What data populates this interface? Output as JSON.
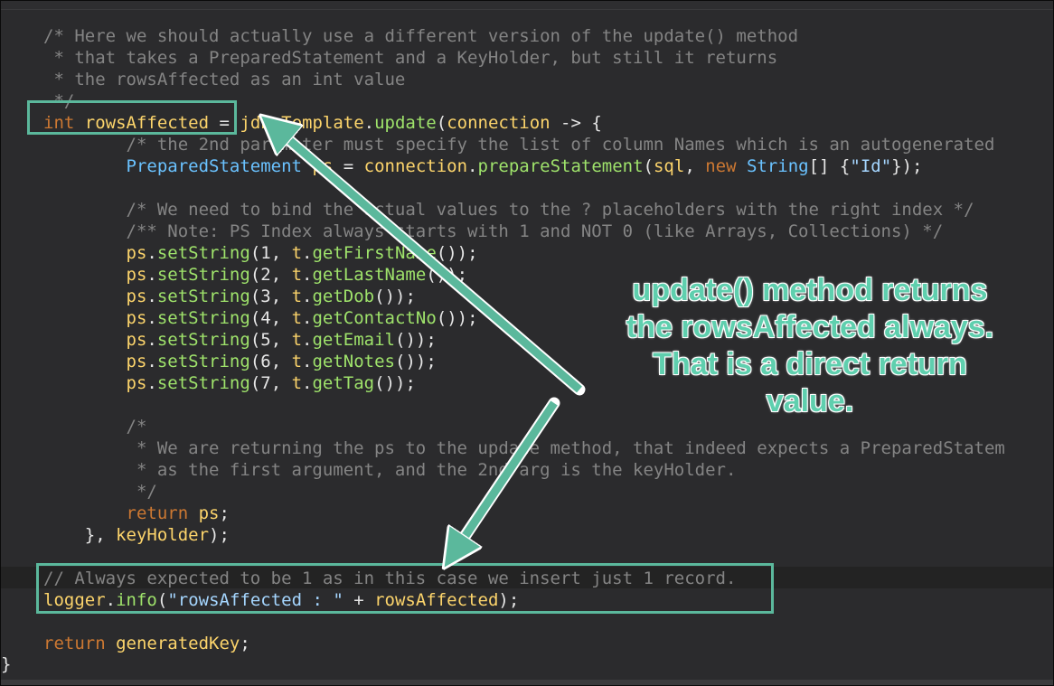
{
  "editor": {
    "lines": [
      {
        "id": "l1",
        "tokens": [
          {
            "t": "c",
            "x": "/* Here we should actually use a different version of the update() method"
          }
        ]
      },
      {
        "id": "l2",
        "tokens": [
          {
            "t": "c",
            "x": " * that takes a PreparedStatement and a KeyHolder, but still it returns"
          }
        ]
      },
      {
        "id": "l3",
        "tokens": [
          {
            "t": "c",
            "x": " * the rowsAffected as an int value"
          }
        ]
      },
      {
        "id": "l4",
        "tokens": [
          {
            "t": "c",
            "x": " */"
          }
        ]
      },
      {
        "id": "l5",
        "tokens": [
          {
            "t": "kw",
            "x": "int "
          },
          {
            "t": "v",
            "x": "rowsAffected"
          },
          {
            "t": "p",
            "x": " = "
          },
          {
            "t": "v",
            "x": "jdbcTemplate"
          },
          {
            "t": "p",
            "x": "."
          },
          {
            "t": "m",
            "x": "update"
          },
          {
            "t": "p",
            "x": "("
          },
          {
            "t": "v",
            "x": "connection"
          },
          {
            "t": "p",
            "x": " -> {"
          }
        ]
      },
      {
        "id": "l6",
        "tokens": [
          {
            "t": "c",
            "x": "        /* the 2nd parameter must specify the list of column Names which is an autogenerated"
          }
        ]
      },
      {
        "id": "l7",
        "tokens": [
          {
            "t": "p",
            "x": "        "
          },
          {
            "t": "s",
            "x": "PreparedStatement"
          },
          {
            "t": "p",
            "x": " "
          },
          {
            "t": "v",
            "x": "ps"
          },
          {
            "t": "p",
            "x": " = "
          },
          {
            "t": "v",
            "x": "connection"
          },
          {
            "t": "p",
            "x": "."
          },
          {
            "t": "m",
            "x": "prepareStatement"
          },
          {
            "t": "p",
            "x": "("
          },
          {
            "t": "v",
            "x": "sql"
          },
          {
            "t": "p",
            "x": ", "
          },
          {
            "t": "kw",
            "x": "new "
          },
          {
            "t": "s",
            "x": "String"
          },
          {
            "t": "p",
            "x": "[] {"
          },
          {
            "t": "st",
            "x": "\"Id\""
          },
          {
            "t": "p",
            "x": "});"
          }
        ]
      },
      {
        "id": "l8",
        "tokens": []
      },
      {
        "id": "l9",
        "tokens": [
          {
            "t": "c",
            "x": "        /* We need to bind the actual values to the ? placeholders with the right index */"
          }
        ]
      },
      {
        "id": "l10",
        "tokens": [
          {
            "t": "c",
            "x": "        /** Note: PS Index always starts with 1 and NOT 0 (like Arrays, Collections) */"
          }
        ]
      },
      {
        "id": "l11",
        "tokens": [
          {
            "t": "p",
            "x": "        "
          },
          {
            "t": "v",
            "x": "ps"
          },
          {
            "t": "p",
            "x": "."
          },
          {
            "t": "m",
            "x": "setString"
          },
          {
            "t": "p",
            "x": "(1, "
          },
          {
            "t": "v",
            "x": "t"
          },
          {
            "t": "p",
            "x": "."
          },
          {
            "t": "m",
            "x": "getFirstName"
          },
          {
            "t": "p",
            "x": "());"
          }
        ]
      },
      {
        "id": "l12",
        "tokens": [
          {
            "t": "p",
            "x": "        "
          },
          {
            "t": "v",
            "x": "ps"
          },
          {
            "t": "p",
            "x": "."
          },
          {
            "t": "m",
            "x": "setString"
          },
          {
            "t": "p",
            "x": "(2, "
          },
          {
            "t": "v",
            "x": "t"
          },
          {
            "t": "p",
            "x": "."
          },
          {
            "t": "m",
            "x": "getLastName"
          },
          {
            "t": "p",
            "x": "());"
          }
        ]
      },
      {
        "id": "l13",
        "tokens": [
          {
            "t": "p",
            "x": "        "
          },
          {
            "t": "v",
            "x": "ps"
          },
          {
            "t": "p",
            "x": "."
          },
          {
            "t": "m",
            "x": "setString"
          },
          {
            "t": "p",
            "x": "(3, "
          },
          {
            "t": "v",
            "x": "t"
          },
          {
            "t": "p",
            "x": "."
          },
          {
            "t": "m",
            "x": "getDob"
          },
          {
            "t": "p",
            "x": "());"
          }
        ]
      },
      {
        "id": "l14",
        "tokens": [
          {
            "t": "p",
            "x": "        "
          },
          {
            "t": "v",
            "x": "ps"
          },
          {
            "t": "p",
            "x": "."
          },
          {
            "t": "m",
            "x": "setString"
          },
          {
            "t": "p",
            "x": "(4, "
          },
          {
            "t": "v",
            "x": "t"
          },
          {
            "t": "p",
            "x": "."
          },
          {
            "t": "m",
            "x": "getContactNo"
          },
          {
            "t": "p",
            "x": "());"
          }
        ]
      },
      {
        "id": "l15",
        "tokens": [
          {
            "t": "p",
            "x": "        "
          },
          {
            "t": "v",
            "x": "ps"
          },
          {
            "t": "p",
            "x": "."
          },
          {
            "t": "m",
            "x": "setString"
          },
          {
            "t": "p",
            "x": "(5, "
          },
          {
            "t": "v",
            "x": "t"
          },
          {
            "t": "p",
            "x": "."
          },
          {
            "t": "m",
            "x": "getEmail"
          },
          {
            "t": "p",
            "x": "());"
          }
        ]
      },
      {
        "id": "l16",
        "tokens": [
          {
            "t": "p",
            "x": "        "
          },
          {
            "t": "v",
            "x": "ps"
          },
          {
            "t": "p",
            "x": "."
          },
          {
            "t": "m",
            "x": "setString"
          },
          {
            "t": "p",
            "x": "(6, "
          },
          {
            "t": "v",
            "x": "t"
          },
          {
            "t": "p",
            "x": "."
          },
          {
            "t": "m",
            "x": "getNotes"
          },
          {
            "t": "p",
            "x": "());"
          }
        ]
      },
      {
        "id": "l17",
        "tokens": [
          {
            "t": "p",
            "x": "        "
          },
          {
            "t": "v",
            "x": "ps"
          },
          {
            "t": "p",
            "x": "."
          },
          {
            "t": "m",
            "x": "setString"
          },
          {
            "t": "p",
            "x": "(7, "
          },
          {
            "t": "v",
            "x": "t"
          },
          {
            "t": "p",
            "x": "."
          },
          {
            "t": "m",
            "x": "getTag"
          },
          {
            "t": "p",
            "x": "());"
          }
        ]
      },
      {
        "id": "l18",
        "tokens": []
      },
      {
        "id": "l19",
        "tokens": [
          {
            "t": "c",
            "x": "        /*"
          }
        ]
      },
      {
        "id": "l20",
        "tokens": [
          {
            "t": "c",
            "x": "         * We are returning the ps to the update method, that indeed expects a PreparedStatem"
          }
        ]
      },
      {
        "id": "l21",
        "tokens": [
          {
            "t": "c",
            "x": "         * as the first argument, and the 2nd arg is the keyHolder."
          }
        ]
      },
      {
        "id": "l22",
        "tokens": [
          {
            "t": "c",
            "x": "         */"
          }
        ]
      },
      {
        "id": "l23",
        "tokens": [
          {
            "t": "p",
            "x": "        "
          },
          {
            "t": "kw",
            "x": "return "
          },
          {
            "t": "v",
            "x": "ps"
          },
          {
            "t": "p",
            "x": ";"
          }
        ]
      },
      {
        "id": "l24",
        "tokens": [
          {
            "t": "p",
            "x": "    }, "
          },
          {
            "t": "v",
            "x": "keyHolder"
          },
          {
            "t": "p",
            "x": ");"
          }
        ]
      },
      {
        "id": "l25",
        "tokens": []
      },
      {
        "id": "l26",
        "tokens": [
          {
            "t": "c",
            "x": "// Always expected to be 1 as in this case we insert just 1 record."
          }
        ]
      },
      {
        "id": "l27",
        "tokens": [
          {
            "t": "v",
            "x": "logger"
          },
          {
            "t": "p",
            "x": "."
          },
          {
            "t": "m",
            "x": "info"
          },
          {
            "t": "p",
            "x": "("
          },
          {
            "t": "st",
            "x": "\"rowsAffected : \""
          },
          {
            "t": "p",
            "x": " + "
          },
          {
            "t": "v",
            "x": "rowsAffected"
          },
          {
            "t": "p",
            "x": ");"
          }
        ]
      },
      {
        "id": "l28",
        "tokens": []
      },
      {
        "id": "l29",
        "tokens": [
          {
            "t": "kw",
            "x": "return "
          },
          {
            "t": "v",
            "x": "generatedKey"
          },
          {
            "t": "p",
            "x": ";"
          }
        ]
      }
    ],
    "closing_brace": "}"
  },
  "annotation": {
    "callout_lines": [
      "update() method returns",
      "the rowsAffected always.",
      "That is a direct return",
      "value."
    ],
    "accent_color": "#5bb89c"
  }
}
